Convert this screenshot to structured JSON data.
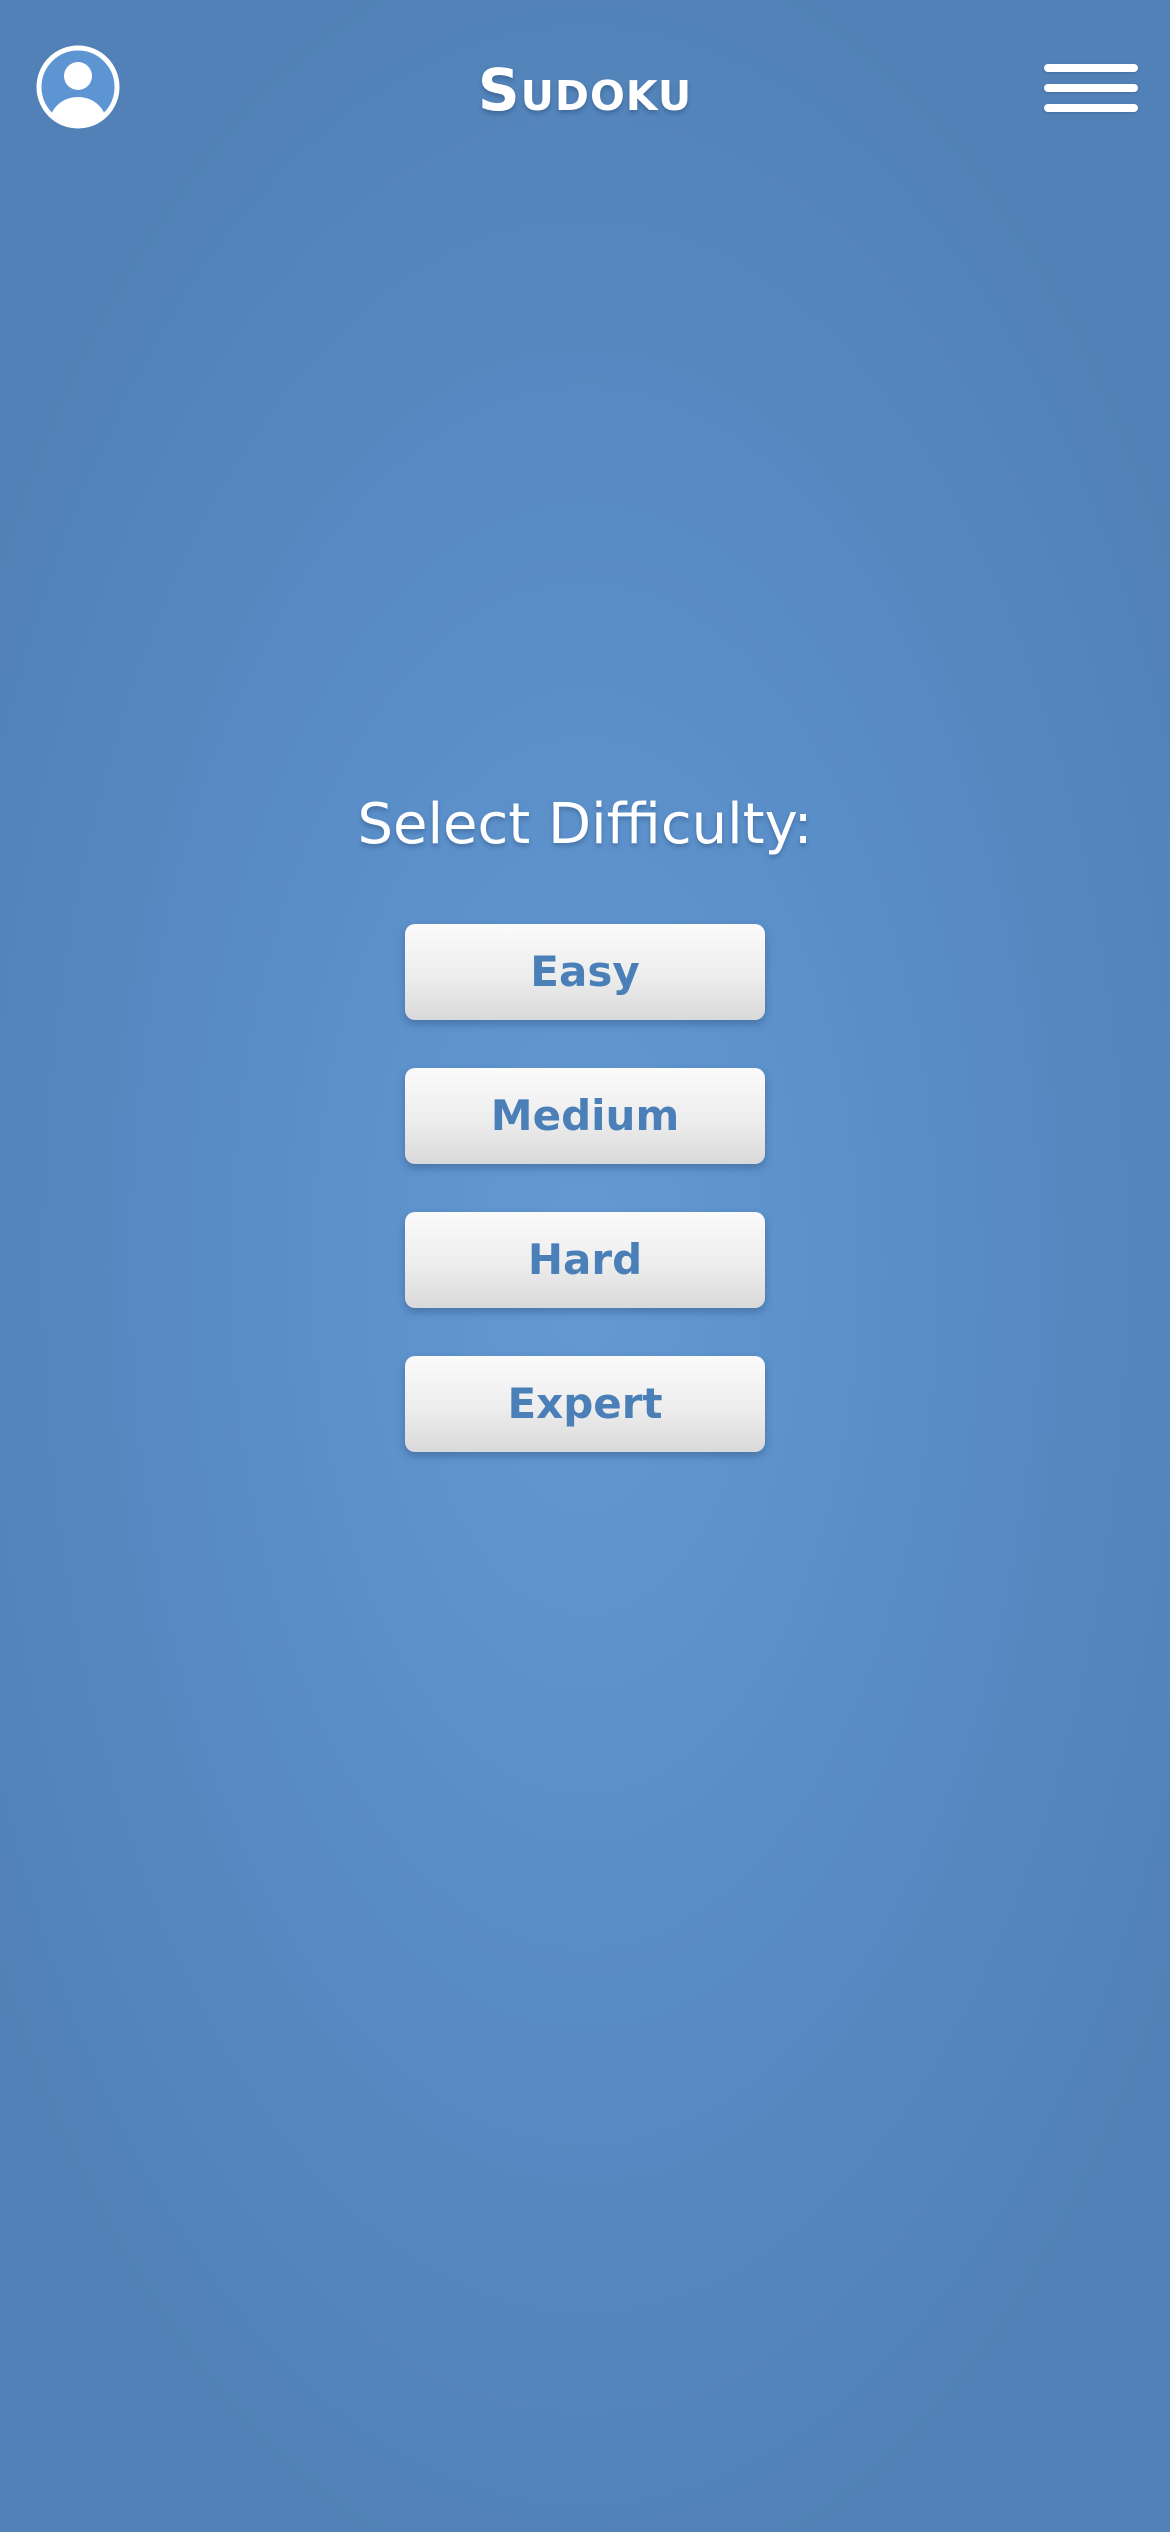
{
  "header": {
    "title": "Sudoku",
    "profile_icon": "user-avatar-icon",
    "menu_icon": "hamburger-menu-icon"
  },
  "difficulty": {
    "heading": "Select Difficulty:",
    "options": [
      {
        "label": "Easy"
      },
      {
        "label": "Medium"
      },
      {
        "label": "Hard"
      },
      {
        "label": "Expert"
      }
    ]
  },
  "colors": {
    "background": "#5a8ec8",
    "button_text": "#4a7fb8",
    "button_face": "#f0f0f0",
    "title_text": "#ffffff"
  }
}
